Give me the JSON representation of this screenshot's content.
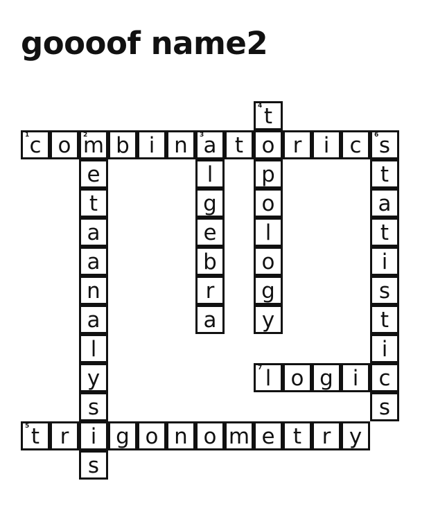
{
  "title": "goooof name2",
  "cells": [
    {
      "row": 0,
      "col": 8,
      "letter": "t",
      "number": "4"
    },
    {
      "row": 1,
      "col": 0,
      "letter": "c",
      "number": "1"
    },
    {
      "row": 1,
      "col": 1,
      "letter": "o"
    },
    {
      "row": 1,
      "col": 2,
      "letter": "m",
      "number": "2"
    },
    {
      "row": 1,
      "col": 3,
      "letter": "b"
    },
    {
      "row": 1,
      "col": 4,
      "letter": "i"
    },
    {
      "row": 1,
      "col": 5,
      "letter": "n"
    },
    {
      "row": 1,
      "col": 6,
      "letter": "a",
      "number": "3"
    },
    {
      "row": 1,
      "col": 7,
      "letter": "t"
    },
    {
      "row": 1,
      "col": 8,
      "letter": "o"
    },
    {
      "row": 1,
      "col": 9,
      "letter": "r"
    },
    {
      "row": 1,
      "col": 10,
      "letter": "i"
    },
    {
      "row": 1,
      "col": 11,
      "letter": "c"
    },
    {
      "row": 1,
      "col": 12,
      "letter": "s",
      "number": "6"
    },
    {
      "row": 2,
      "col": 2,
      "letter": "e"
    },
    {
      "row": 2,
      "col": 6,
      "letter": "l"
    },
    {
      "row": 2,
      "col": 8,
      "letter": "p"
    },
    {
      "row": 2,
      "col": 12,
      "letter": "t"
    },
    {
      "row": 3,
      "col": 2,
      "letter": "t"
    },
    {
      "row": 3,
      "col": 6,
      "letter": "g"
    },
    {
      "row": 3,
      "col": 8,
      "letter": "o"
    },
    {
      "row": 3,
      "col": 12,
      "letter": "a"
    },
    {
      "row": 4,
      "col": 2,
      "letter": "a"
    },
    {
      "row": 4,
      "col": 6,
      "letter": "e"
    },
    {
      "row": 4,
      "col": 8,
      "letter": "l"
    },
    {
      "row": 4,
      "col": 12,
      "letter": "t"
    },
    {
      "row": 5,
      "col": 2,
      "letter": "a"
    },
    {
      "row": 5,
      "col": 6,
      "letter": "b"
    },
    {
      "row": 5,
      "col": 8,
      "letter": "o"
    },
    {
      "row": 5,
      "col": 12,
      "letter": "i"
    },
    {
      "row": 6,
      "col": 2,
      "letter": "n"
    },
    {
      "row": 6,
      "col": 6,
      "letter": "r"
    },
    {
      "row": 6,
      "col": 8,
      "letter": "g"
    },
    {
      "row": 6,
      "col": 12,
      "letter": "s"
    },
    {
      "row": 7,
      "col": 2,
      "letter": "a"
    },
    {
      "row": 7,
      "col": 6,
      "letter": "a"
    },
    {
      "row": 7,
      "col": 8,
      "letter": "y"
    },
    {
      "row": 7,
      "col": 12,
      "letter": "t"
    },
    {
      "row": 8,
      "col": 2,
      "letter": "l"
    },
    {
      "row": 8,
      "col": 12,
      "letter": "i"
    },
    {
      "row": 9,
      "col": 2,
      "letter": "y"
    },
    {
      "row": 9,
      "col": 8,
      "letter": "l",
      "number": "7"
    },
    {
      "row": 9,
      "col": 9,
      "letter": "o"
    },
    {
      "row": 9,
      "col": 10,
      "letter": "g"
    },
    {
      "row": 9,
      "col": 11,
      "letter": "i"
    },
    {
      "row": 9,
      "col": 12,
      "letter": "c"
    },
    {
      "row": 10,
      "col": 2,
      "letter": "s"
    },
    {
      "row": 10,
      "col": 12,
      "letter": "s"
    },
    {
      "row": 11,
      "col": 0,
      "letter": "t",
      "number": "5"
    },
    {
      "row": 11,
      "col": 1,
      "letter": "r"
    },
    {
      "row": 11,
      "col": 2,
      "letter": "i"
    },
    {
      "row": 11,
      "col": 3,
      "letter": "g"
    },
    {
      "row": 11,
      "col": 4,
      "letter": "o"
    },
    {
      "row": 11,
      "col": 5,
      "letter": "n"
    },
    {
      "row": 11,
      "col": 6,
      "letter": "o"
    },
    {
      "row": 11,
      "col": 7,
      "letter": "m"
    },
    {
      "row": 11,
      "col": 8,
      "letter": "e"
    },
    {
      "row": 11,
      "col": 9,
      "letter": "t"
    },
    {
      "row": 11,
      "col": 10,
      "letter": "r"
    },
    {
      "row": 11,
      "col": 11,
      "letter": "y"
    },
    {
      "row": 12,
      "col": 2,
      "letter": "s"
    }
  ]
}
